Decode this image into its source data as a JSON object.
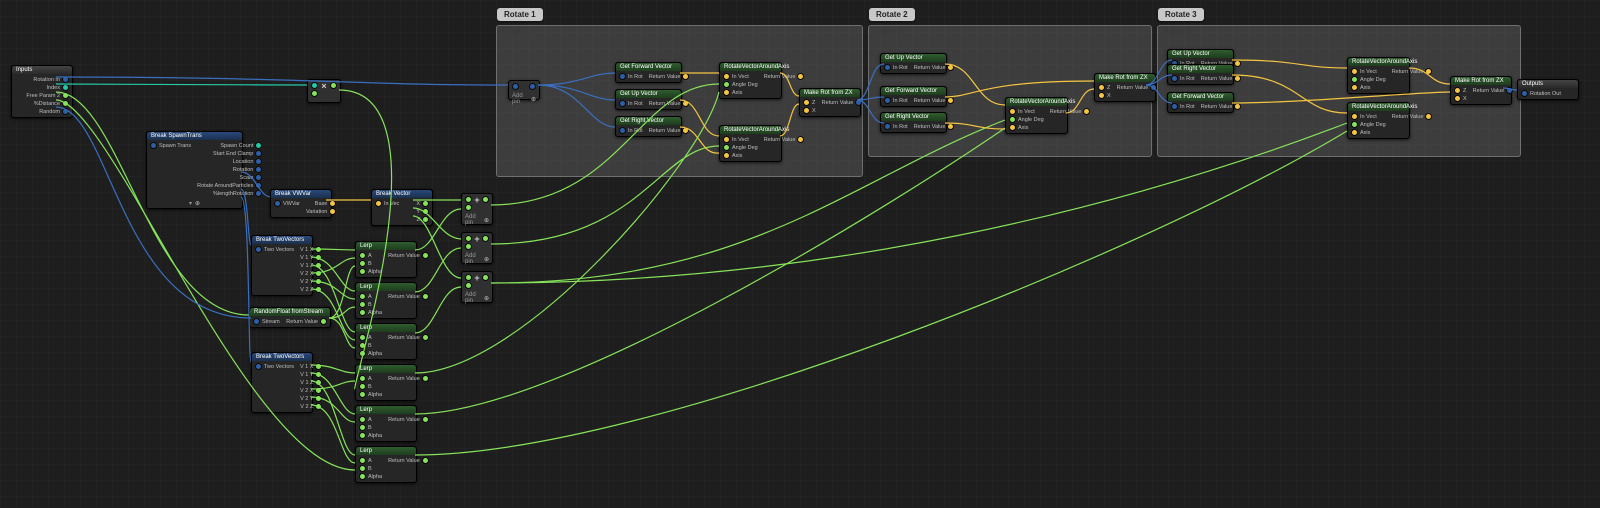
{
  "groups": {
    "r1": {
      "label": "Rotate 1",
      "title": "Rotate 1"
    },
    "r2": {
      "label": "Rotate 2",
      "title": "Rotate 2"
    },
    "r3": {
      "label": "Rotate 3",
      "title": "Rotate 3"
    }
  },
  "nodes": {
    "inputs": {
      "title": "Inputs",
      "pins": [
        "Rotation In",
        "Index",
        "Free Param 2",
        "%Distance",
        "Random"
      ]
    },
    "outputs": {
      "title": "Outputs",
      "pins": [
        "Rotation Out"
      ]
    },
    "breakSpawnTrans": {
      "title": "Break SpawnTrans",
      "in": [
        "Spawn Trans"
      ],
      "out": [
        "Spawn Count",
        "Start End Clamp",
        "Location",
        "Rotation",
        "Scale",
        "Rotate AroundParticles",
        "%lengthRotation"
      ]
    },
    "breakVWvar": {
      "title": "Break VWVar",
      "in": [
        "VWVar"
      ],
      "out": [
        "Base",
        "Variation"
      ]
    },
    "breakVector": {
      "title": "Break Vector",
      "in": [
        "In Vec"
      ],
      "out": [
        "X",
        "Y",
        "Z"
      ]
    },
    "breakTwoVectorsA": {
      "title": "Break TwoVectors",
      "in": [
        "Two Vectors"
      ],
      "out": [
        "V 1 X",
        "V 1 Y",
        "V 1 Z",
        "V 2 X",
        "V 2 Y",
        "V 2 Z"
      ]
    },
    "breakTwoVectorsB": {
      "title": "Break TwoVectors",
      "in": [
        "Two Vectors"
      ],
      "out": [
        "V 1 X",
        "V 1 Y",
        "V 1 Z",
        "V 2 X",
        "V 2 Y",
        "V 2 Z"
      ]
    },
    "rfs": {
      "title": "RandomFloat fromStream",
      "in": [
        "Stream"
      ],
      "out": [
        "Return Value"
      ]
    },
    "lerp": {
      "title": "Lerp",
      "in": [
        "A",
        "B",
        "Alpha"
      ],
      "out": [
        "Return Value"
      ]
    },
    "getFwd": {
      "title": "Get Forward Vector",
      "in": [
        "In Rot"
      ],
      "out": [
        "Return Value"
      ]
    },
    "getUp": {
      "title": "Get Up Vector",
      "in": [
        "In Rot"
      ],
      "out": [
        "Return Value"
      ]
    },
    "getRight": {
      "title": "Get Right Vector",
      "in": [
        "In Rot"
      ],
      "out": [
        "Return Value"
      ]
    },
    "rvaa": {
      "title": "RotateVectorAroundAxis",
      "in": [
        "In Vect",
        "Angle Deg",
        "Axis"
      ],
      "out": [
        "Return Value"
      ]
    },
    "makeRot": {
      "title": "Make Rot from ZX",
      "in": [
        "Z",
        "X"
      ],
      "out": [
        "Return Value"
      ]
    }
  },
  "labels": {
    "addpin": "Add pin"
  }
}
